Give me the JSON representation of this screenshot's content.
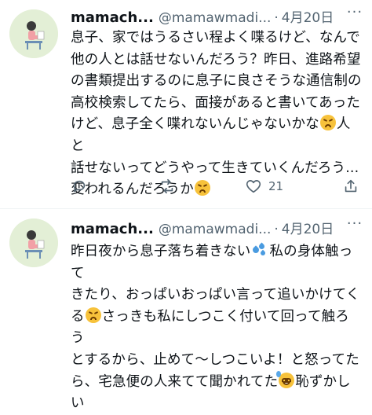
{
  "tweets": [
    {
      "author_name": "mamach...",
      "handle": "@mamawmadi...",
      "separator": "·",
      "date": "4月20日",
      "more_label": "···",
      "text_lines": [
        "息子、家ではうるさい程よく喋るけど、なんで",
        "他の人とは話せないんだろう？昨日、進路希望",
        "の書類提出するのに息子に良さそうな通信制の",
        "高校検索してたら、面接があると書いてあった",
        "けど、息子全く喋れないんじゃないかな",
        "人と",
        "話せないってどうやって生きていくんだろう...",
        "変われるんだろうか"
      ],
      "emojis": [
        "persevering-face-emoji",
        "persevering-face-emoji"
      ],
      "actions": {
        "reply_count": "",
        "retweet_count": "",
        "like_count": "21"
      }
    },
    {
      "author_name": "mamach...",
      "handle": "@mamawmadi...",
      "separator": "·",
      "date": "4月20日",
      "more_label": "···",
      "text_lines": [
        "昨日夜から息子落ち着きない",
        "私の身体触って",
        "きたり、おっぱいおっぱい言って追いかけてく",
        "る",
        "さっきも私にしつこく付いて回って触ろう",
        "とするから、止めて〜しつこいよ！と怒ってた",
        "ら、宅急便の人来てて聞かれてた",
        "恥ずかしい"
      ],
      "emojis": [
        "sweat-droplets-emoji",
        "persevering-face-emoji",
        "grinning-sweat-emoji"
      ]
    }
  ]
}
